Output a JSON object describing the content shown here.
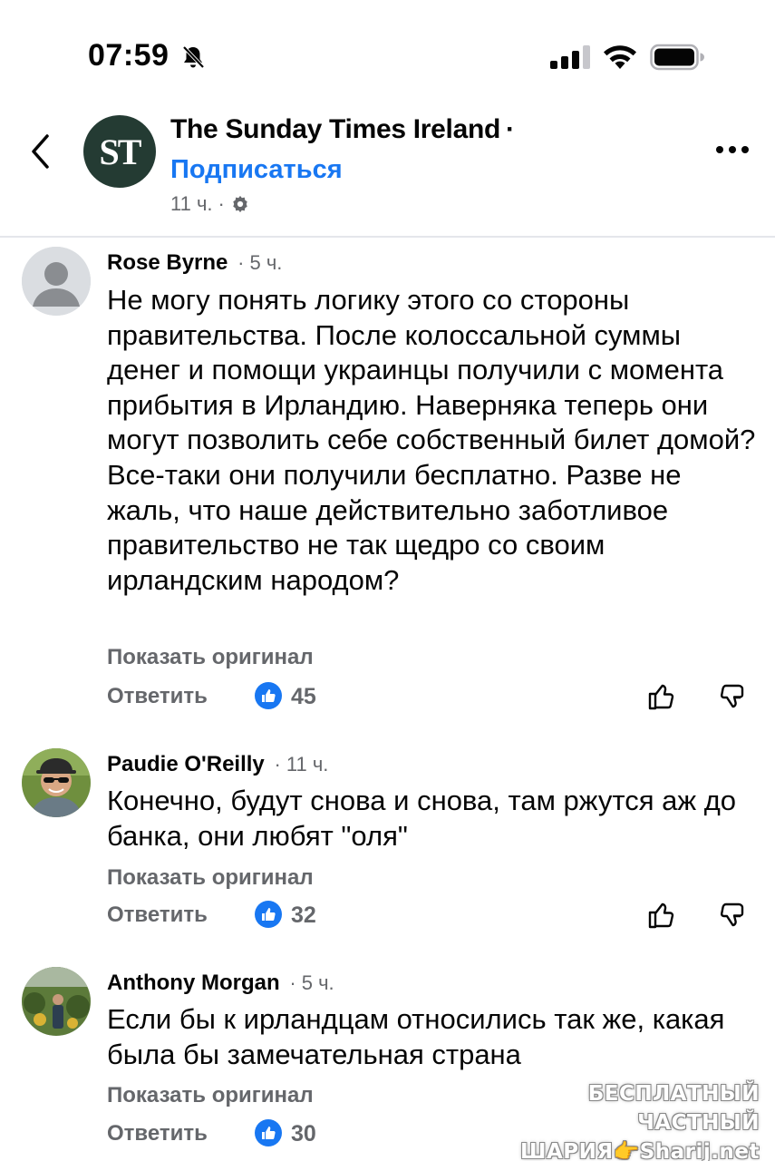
{
  "status_bar": {
    "time": "07:59",
    "icons": [
      "bell-off-icon",
      "signal-icon",
      "wifi-icon",
      "battery-icon"
    ]
  },
  "post_header": {
    "back_icon": "chevron-left-icon",
    "logo_text": "ST",
    "page_name": "The Sunday Times Ireland",
    "separator": "·",
    "subscribe_label": "Подписаться",
    "post_time": "11 ч.",
    "meta_separator": "·",
    "audience_icon": "gear-icon",
    "more_icon": "more-horizontal-icon"
  },
  "comments": [
    {
      "author": "Rose Byrne",
      "time": "· 5 ч.",
      "text": "Не могу понять логику этого со стороны правительства. После колоссальной суммы денег и помощи украинцы получили с момента прибытия в Ирландию. Наверняка теперь они могут позволить себе собственный билет домой? Все-таки они получили бесплатно. Разве не жаль, что наше действительно заботливое правительство не так щедро со своим ирландским народом?",
      "see_original": "Показать оригинал",
      "reply_label": "Ответить",
      "likes": "45"
    },
    {
      "author": "Paudie O'Reilly",
      "time": "· 11 ч.",
      "text": "Конечно, будут снова и снова, там ржутся аж до банка, они любят \"оля\"",
      "see_original": "Показать оригинал",
      "reply_label": "Ответить",
      "likes": "32"
    },
    {
      "author": "Anthony Morgan",
      "time": "· 5 ч.",
      "text": "Если бы к ирландцам относились так же, какая была бы замечательная страна",
      "see_original": "Показать оригинал",
      "reply_label": "Ответить",
      "likes": "30"
    }
  ],
  "watermark": {
    "line1": "БЕСПЛАТНЫЙ ЧАСТНЫЙ",
    "line2": "ШАРИЯ👉Sharij.net"
  },
  "colors": {
    "accent": "#1877f2",
    "secondary_text": "#65676b",
    "logo_bg": "#243b33"
  }
}
